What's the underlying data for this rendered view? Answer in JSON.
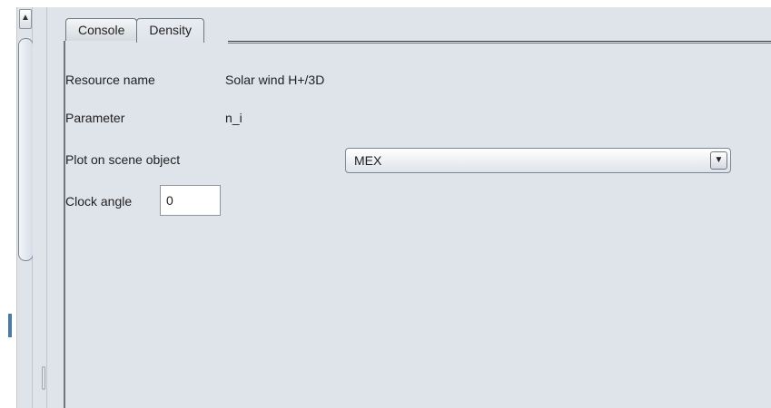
{
  "tabs": [
    {
      "label": "Console",
      "active": false
    },
    {
      "label": "Density",
      "active": true
    }
  ],
  "form": {
    "resource_name_label": "Resource name",
    "resource_name_value": "Solar wind H+/3D",
    "parameter_label": "Parameter",
    "parameter_value": "n_i",
    "plot_on_label": "Plot on scene object",
    "plot_on_value": "MEX",
    "clock_angle_label": "Clock angle",
    "clock_angle_value": "0"
  },
  "icons": {
    "scroll_up": "triangle-up-icon",
    "dropdown": "chevron-down-icon"
  },
  "colors": {
    "panel_background": "#dfe3ea",
    "accent_marker": "#4b7ba5"
  }
}
